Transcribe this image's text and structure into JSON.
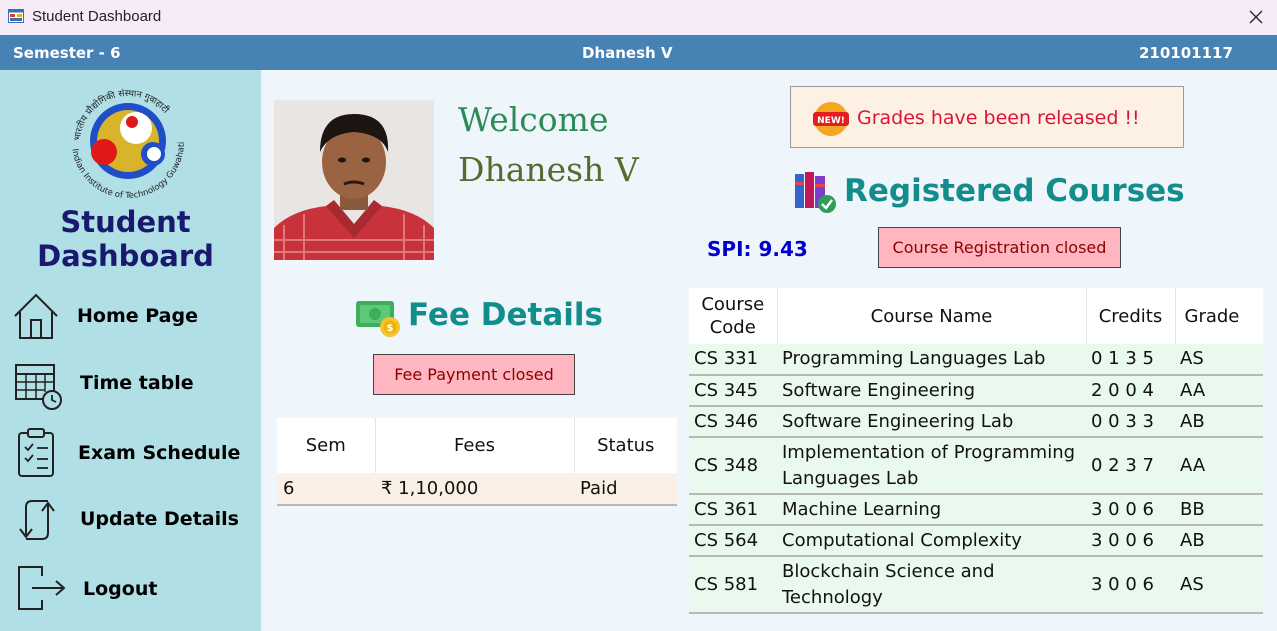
{
  "window": {
    "title": "Student Dashboard",
    "close_glyph": "✕"
  },
  "header": {
    "semester": "Semester - 6",
    "student_name": "Dhanesh V",
    "roll_no": "210101117"
  },
  "sidebar": {
    "logo_text": "Indian Institute of Technology Guwahati",
    "logo_top_text": "भारतीय प्रौद्योगिकी संस्थान गुवाहाटी",
    "title_line1": "Student",
    "title_line2": "Dashboard",
    "items": [
      {
        "label": "Home Page",
        "icon": "home-icon"
      },
      {
        "label": "Time table",
        "icon": "calendar-clock-icon"
      },
      {
        "label": "Exam Schedule",
        "icon": "clipboard-check-icon"
      },
      {
        "label": "Update Details",
        "icon": "sync-arrows-icon"
      },
      {
        "label": "Logout",
        "icon": "logout-icon"
      }
    ]
  },
  "welcome": {
    "line1": "Welcome",
    "line2": "Dhanesh V"
  },
  "notice": {
    "badge": "NEW!",
    "text": "Grades have been released !!"
  },
  "fees": {
    "title": "Fee Details",
    "button": "Fee Payment closed",
    "columns": [
      "Sem",
      "Fees",
      "Status"
    ],
    "rows": [
      {
        "sem": "6",
        "fees": "₹ 1,10,000",
        "status": "Paid"
      }
    ]
  },
  "courses": {
    "title": "Registered Courses",
    "spi": "SPI: 9.43",
    "button": "Course Registration closed",
    "columns": {
      "code_line1": "Course",
      "code_line2": "Code",
      "name": "Course Name",
      "credits": "Credits",
      "grade": "Grade"
    },
    "rows": [
      {
        "code": "CS 331",
        "name": "Programming Languages Lab",
        "credits": "0 1 3 5",
        "grade": "AS"
      },
      {
        "code": "CS 345",
        "name": "Software Engineering",
        "credits": "2 0 0 4",
        "grade": "AA"
      },
      {
        "code": "CS 346",
        "name": "Software Engineering Lab",
        "credits": "0 0 3 3",
        "grade": "AB"
      },
      {
        "code": "CS 348",
        "name": "Implementation of Programming Languages Lab",
        "credits": "0 2 3 7",
        "grade": "AA"
      },
      {
        "code": "CS 361",
        "name": "Machine Learning",
        "credits": "3 0 0 6",
        "grade": "BB"
      },
      {
        "code": "CS 564",
        "name": "Computational Complexity",
        "credits": "3 0 0 6",
        "grade": "AB"
      },
      {
        "code": "CS 581",
        "name": "Blockchain Science and Technology",
        "credits": "3 0 0 6",
        "grade": "AS"
      }
    ]
  },
  "colors": {
    "header_bg": "#4682b4",
    "sidebar_bg": "#b0dfe6",
    "section_title": "#138c8c",
    "notice_text": "#dc143c",
    "spi": "#0000cd",
    "closed_button": "#ffb6c1"
  }
}
